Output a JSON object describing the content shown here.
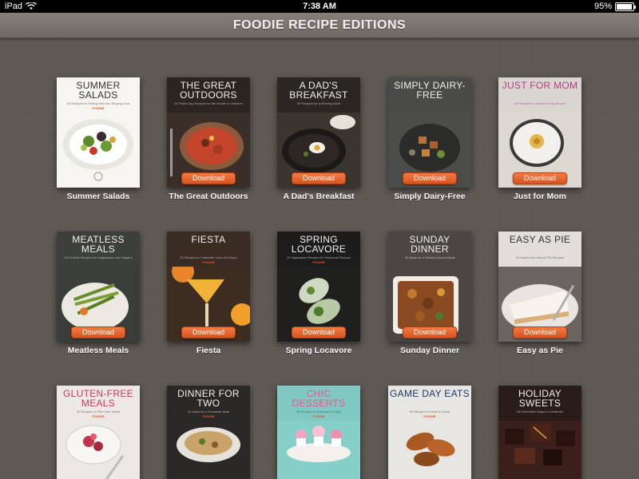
{
  "status_bar": {
    "device": "iPad",
    "time": "7:38 AM",
    "battery": "95%"
  },
  "header": {
    "title": "FOODIE RECIPE EDITIONS"
  },
  "editions": [
    {
      "name": "Summer Salads",
      "cover_title": "SUMMER SALADS",
      "cover_sub": "20 Recipes for Eating Well and Staying Cool",
      "brand": "FOODIE",
      "download": "",
      "icon": "salad-plate"
    },
    {
      "name": "The Great Outdoors",
      "cover_title": "THE GREAT OUTDOORS",
      "cover_sub": "10 Picnic Day Recipes for the Hunter & Gatherer",
      "brand": "",
      "download": "Download",
      "icon": "pot-stew"
    },
    {
      "name": "A Dad's Breakfast",
      "cover_title": "A DAD'S BREAKFAST",
      "cover_sub": "40 Recipes for a Morning Meal",
      "brand": "",
      "download": "Download",
      "icon": "skillet-egg"
    },
    {
      "name": "Simply Dairy-Free",
      "cover_title": "SIMPLY DAIRY-FREE",
      "cover_sub": "",
      "brand": "",
      "download": "Download",
      "icon": "bowl-tofu"
    },
    {
      "name": "Just for Mom",
      "cover_title": "JUST FOR MOM",
      "cover_sub": "20 Recipes for Mother's Day Brunch",
      "brand": "",
      "download": "Download",
      "icon": "plate-dessert"
    },
    {
      "name": "Meatless Meals",
      "cover_title": "MEATLESS MEALS",
      "cover_sub": "40 Flexible Recipes for Vegetarians and Vegans",
      "brand": "",
      "download": "Download",
      "icon": "asparagus-plate"
    },
    {
      "name": "Fiesta",
      "cover_title": "FIESTA",
      "cover_sub": "20 Recipes to Celebrate Cinco De Mayo",
      "brand": "FOODIE",
      "download": "Download",
      "icon": "margarita"
    },
    {
      "name": "Spring Locavore",
      "cover_title": "SPRING LOCAVORE",
      "cover_sub": "20 Vegetarian Recipes for Seasonal Produce",
      "brand": "FOODIE",
      "download": "Download",
      "icon": "spring-rolls"
    },
    {
      "name": "Sunday Dinner",
      "cover_title": "SUNDAY DINNER",
      "cover_sub": "40 Ideas for a Weekly Dinner Ritual",
      "brand": "",
      "download": "Download",
      "icon": "casserole"
    },
    {
      "name": "Easy as Pie",
      "cover_title": "EASY AS PIE",
      "cover_sub": "40 Sweet and Savory Pie Recipes",
      "brand": "",
      "download": "Download",
      "icon": "pie-slice"
    },
    {
      "name": "",
      "cover_title": "GLUTEN-FREE MEALS",
      "cover_sub": "30 Recipes to Plan Your Week",
      "brand": "FOODIE",
      "download": "",
      "icon": "berry-bowl"
    },
    {
      "name": "",
      "cover_title": "DINNER FOR TWO",
      "cover_sub": "40 Ideas for a Romantic Meal",
      "brand": "FOODIE",
      "download": "",
      "icon": "pasta-bowl"
    },
    {
      "name": "",
      "cover_title": "CHIC DESSERTS",
      "cover_sub": "40 Recipes to Entertain in Style",
      "brand": "FOODIE",
      "download": "",
      "icon": "cupcakes"
    },
    {
      "name": "",
      "cover_title": "GAME DAY EATS",
      "cover_sub": "40 Recipes to Feed a Crowd",
      "brand": "FOODIE",
      "download": "",
      "icon": "chicken-wings"
    },
    {
      "name": "",
      "cover_title": "HOLIDAY SWEETS",
      "cover_sub": "40 Delectable Ways to Celebrate",
      "brand": "",
      "download": "",
      "icon": "chocolates"
    }
  ],
  "colors": {
    "download_button": "#e0612a",
    "background": "#5f5954",
    "header": "#7a746f"
  }
}
